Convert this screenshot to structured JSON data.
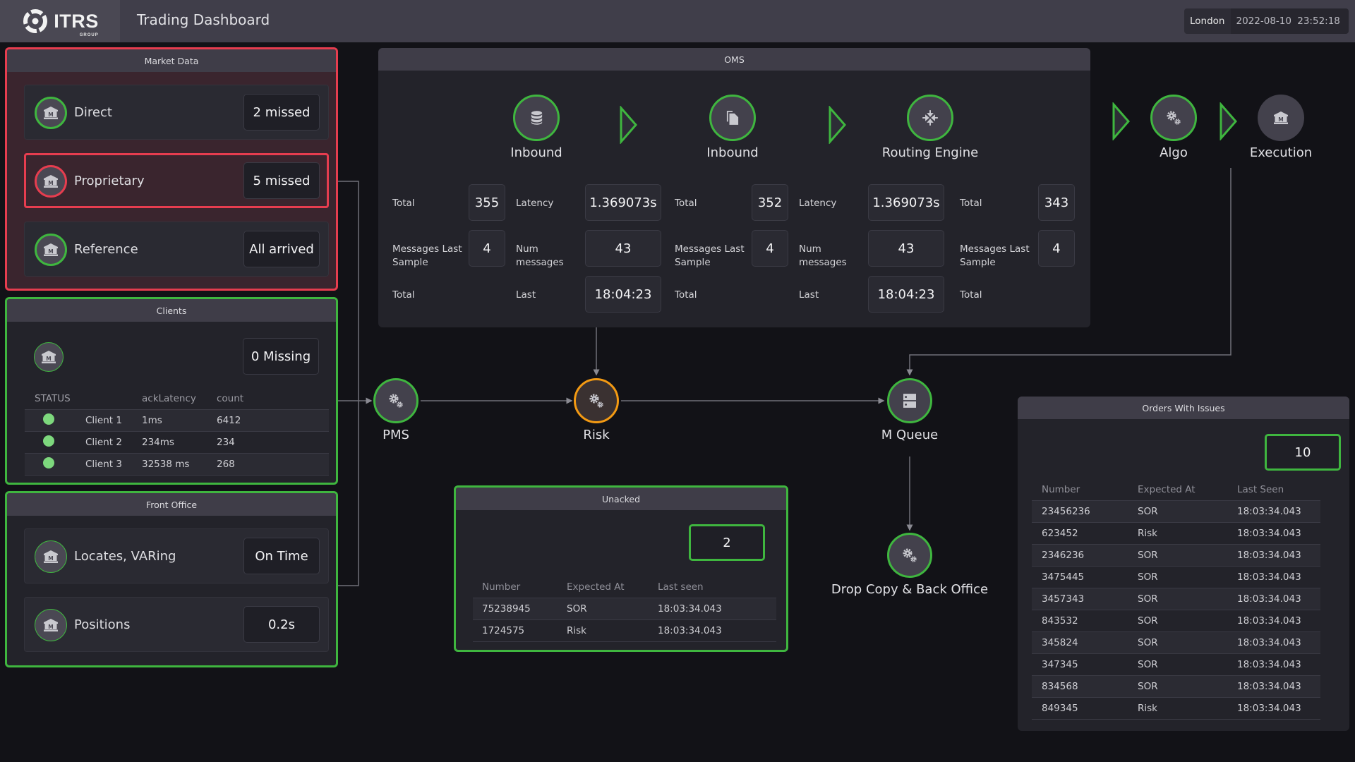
{
  "header": {
    "logo_text": "ITRS",
    "logo_sub": "GROUP",
    "title": "Trading Dashboard",
    "location": "London",
    "datetime": "2022-08-10  23:52:18"
  },
  "colors": {
    "ok": "#3fb63f",
    "alert": "#e63d4f",
    "warning": "#f39a13",
    "status_dot": "#7dd87d"
  },
  "market_data": {
    "title": "Market Data",
    "status": "alert",
    "items": [
      {
        "label": "Direct",
        "value": "2 missed",
        "status": "ok",
        "icon": "bank-icon"
      },
      {
        "label": "Proprietary",
        "value": "5 missed",
        "status": "alert",
        "icon": "bank-icon"
      },
      {
        "label": "Reference",
        "value": "All arrived",
        "status": "ok",
        "icon": "bank-icon"
      }
    ]
  },
  "clients": {
    "title": "Clients",
    "status": "ok",
    "icon": "bank-icon",
    "value": "0 Missing",
    "columns": [
      "STATUS",
      "",
      "ackLatency",
      "count"
    ],
    "rows": [
      {
        "status": "ok",
        "name": "Client 1",
        "ackLatency": "1ms",
        "count": "6412"
      },
      {
        "status": "ok",
        "name": "Client 2",
        "ackLatency": "234ms",
        "count": "234"
      },
      {
        "status": "ok",
        "name": "Client 3",
        "ackLatency": "32538 ms",
        "count": "268"
      }
    ]
  },
  "front_office": {
    "title": "Front Office",
    "status": "ok",
    "items": [
      {
        "label": "Locates, VARing",
        "value": "On Time",
        "icon": "bank-icon"
      },
      {
        "label": "Positions",
        "value": "0.2s",
        "icon": "bank-icon"
      }
    ]
  },
  "oms": {
    "title": "OMS",
    "nodes": [
      {
        "label": "Inbound",
        "icon": "database-icon",
        "status": "ok"
      },
      {
        "label": "Inbound",
        "icon": "document-icon",
        "status": "ok"
      },
      {
        "label": "Routing Engine",
        "icon": "compress-icon",
        "status": "ok"
      }
    ],
    "col1": {
      "total_label": "Total",
      "total": "355",
      "mls_label": "Messages Last Sample",
      "mls": "4",
      "total2_label": "Total"
    },
    "col2": {
      "latency_label": "Latency",
      "latency": "1.369073s",
      "num_label": "Num messages",
      "num": "43",
      "last_label": "Last",
      "last": "18:04:23"
    },
    "col3": {
      "total_label": "Total",
      "total": "352",
      "mls_label": "Messages Last Sample",
      "mls": "4",
      "total2_label": "Total"
    },
    "col4": {
      "latency_label": "Latency",
      "latency": "1.369073s",
      "num_label": "Num messages",
      "num": "43",
      "last_label": "Last",
      "last": "18:04:23"
    },
    "col5": {
      "total_label": "Total",
      "total": "343",
      "mls_label": "Messages Last Sample",
      "mls": "4",
      "total2_label": "Total"
    }
  },
  "outer_nodes": {
    "algo": {
      "label": "Algo",
      "icon": "gears-icon",
      "status": "ok"
    },
    "execution": {
      "label": "Execution",
      "icon": "bank-icon",
      "status": "none"
    }
  },
  "flow": {
    "pms": {
      "label": "PMS",
      "icon": "gears-icon",
      "status": "ok"
    },
    "risk": {
      "label": "Risk",
      "icon": "gears-icon",
      "status": "warning"
    },
    "mqueue": {
      "label": "M Queue",
      "icon": "server-icon",
      "status": "ok"
    },
    "dropcopy": {
      "label": "Drop Copy & Back Office",
      "icon": "gears-icon",
      "status": "ok"
    }
  },
  "unacked": {
    "title": "Unacked",
    "count": "2",
    "columns": [
      "Number",
      "Expected At",
      "Last seen"
    ],
    "rows": [
      {
        "number": "75238945",
        "expected": "SOR",
        "last": "18:03:34.043"
      },
      {
        "number": "1724575",
        "expected": "Risk",
        "last": "18:03:34.043"
      }
    ]
  },
  "orders_with_issues": {
    "title": "Orders With Issues",
    "count": "10",
    "columns": [
      "Number",
      "Expected At",
      "Last Seen"
    ],
    "rows": [
      {
        "number": "23456236",
        "expected": "SOR",
        "last": "18:03:34.043"
      },
      {
        "number": "623452",
        "expected": "Risk",
        "last": "18:03:34.043"
      },
      {
        "number": "2346236",
        "expected": "SOR",
        "last": "18:03:34.043"
      },
      {
        "number": "3475445",
        "expected": "SOR",
        "last": "18:03:34.043"
      },
      {
        "number": "3457343",
        "expected": "SOR",
        "last": "18:03:34.043"
      },
      {
        "number": "843532",
        "expected": "SOR",
        "last": "18:03:34.043"
      },
      {
        "number": "345824",
        "expected": "SOR",
        "last": "18:03:34.043"
      },
      {
        "number": "347345",
        "expected": "SOR",
        "last": "18:03:34.043"
      },
      {
        "number": "834568",
        "expected": "SOR",
        "last": "18:03:34.043"
      },
      {
        "number": "849345",
        "expected": "Risk",
        "last": "18:03:34.043"
      }
    ]
  }
}
